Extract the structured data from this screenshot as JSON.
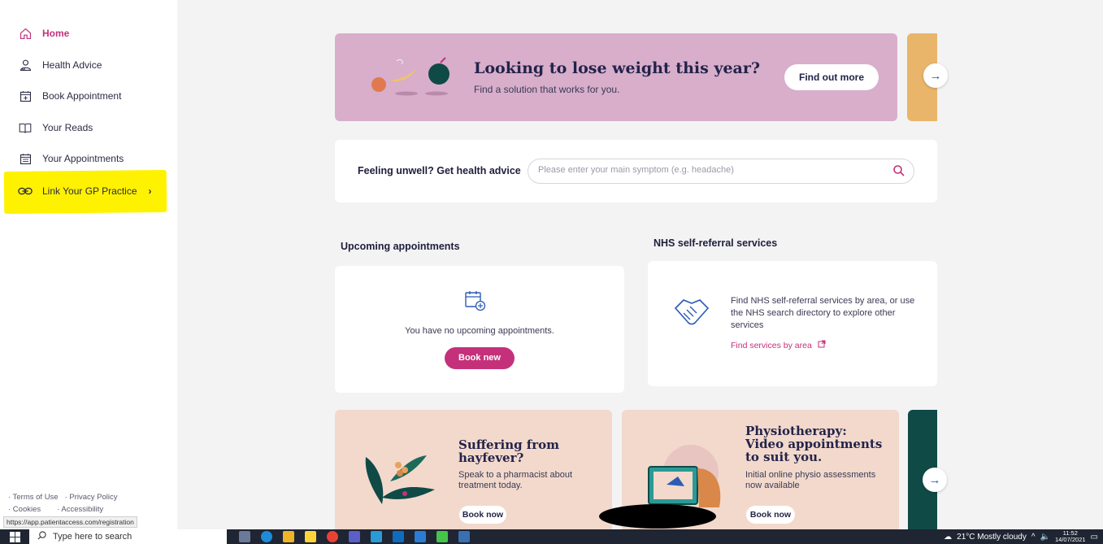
{
  "sidebar": {
    "items": [
      {
        "label": "Home",
        "icon": "home-icon"
      },
      {
        "label": "Health Advice",
        "icon": "stethoscope-icon"
      },
      {
        "label": "Book Appointment",
        "icon": "calendar-plus-icon"
      },
      {
        "label": "Your Reads",
        "icon": "book-icon"
      },
      {
        "label": "Your Appointments",
        "icon": "calendar-list-icon"
      },
      {
        "label": "Link Your GP Practice",
        "icon": "link-icon"
      }
    ],
    "footer": {
      "terms": "· Terms of Use",
      "privacy": "· Privacy Policy",
      "cookies": "· Cookies",
      "accessibility": "· Accessibility"
    },
    "status_url": "https://app.patientaccess.com/registration"
  },
  "banner": {
    "title": "Looking to lose weight this year?",
    "subtitle": "Find a solution that works for you.",
    "button": "Find out more"
  },
  "advice": {
    "label": "Feeling unwell? Get health advice",
    "placeholder": "Please enter your main symptom (e.g. headache)"
  },
  "appointments": {
    "title": "Upcoming appointments",
    "empty_text": "You have no upcoming appointments.",
    "button": "Book new"
  },
  "nhs": {
    "title": "NHS self-referral services",
    "text": "Find NHS self-referral services by area, or use the NHS search directory to explore other services",
    "link": "Find services by area"
  },
  "promos": [
    {
      "title": "Suffering from hayfever?",
      "text": "Speak to a pharmacist about treatment today.",
      "button": "Book now"
    },
    {
      "title": "Physiotherapy: Video appointments to suit you.",
      "text": "Initial online physio assessments now available",
      "button": "Book now"
    }
  ],
  "taskbar": {
    "search": "Type here to search",
    "weather": "21°C  Mostly cloudy",
    "time": "11:52",
    "date": "14/07/2021"
  },
  "colors": {
    "accent": "#c4317a",
    "banner_bg": "#d8aecb",
    "promo_bg": "#f2d9cc",
    "highlight": "#fff200"
  }
}
